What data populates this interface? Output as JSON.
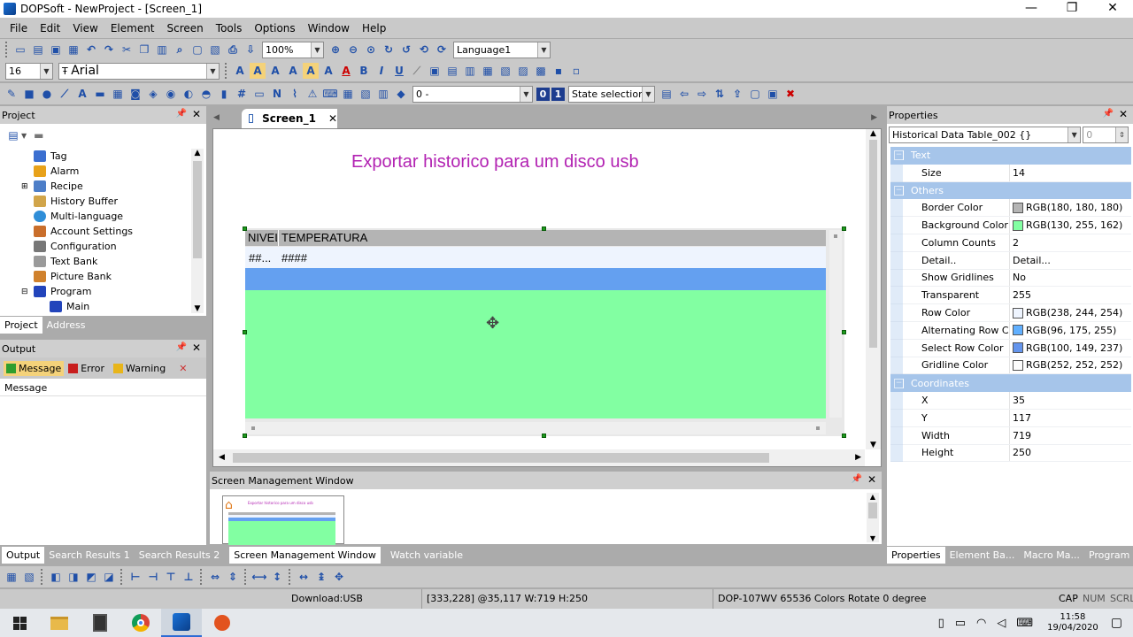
{
  "window": {
    "title": "DOPSoft - NewProject - [Screen_1]",
    "minimize": "—",
    "maximize": "❐",
    "close": "✕"
  },
  "menu": [
    "File",
    "Edit",
    "View",
    "Element",
    "Screen",
    "Tools",
    "Options",
    "Window",
    "Help"
  ],
  "toolbar1": {
    "zoom": "100%",
    "language": "Language1"
  },
  "toolbar2": {
    "font_size": "16",
    "font_name": "Arial"
  },
  "toolbar3": {
    "state_combo": "0 -",
    "state_a": "0",
    "state_b": "1",
    "state_selection": "State selection..."
  },
  "project_panel": {
    "title": "Project",
    "items": [
      {
        "label": "Tag",
        "icon": "tag-icon",
        "color": "#3b6fd0"
      },
      {
        "label": "Alarm",
        "icon": "alarm-icon",
        "color": "#e8a21a"
      },
      {
        "label": "Recipe",
        "icon": "recipe-icon",
        "color": "#4d7ec8"
      },
      {
        "label": "History Buffer",
        "icon": "history-buffer-icon",
        "color": "#d1a54a"
      },
      {
        "label": "Multi-language",
        "icon": "globe-icon",
        "color": "#2f8ed8"
      },
      {
        "label": "Account Settings",
        "icon": "account-icon",
        "color": "#c96e2b"
      },
      {
        "label": "Configuration",
        "icon": "configuration-icon",
        "color": "#777777"
      },
      {
        "label": "Text Bank",
        "icon": "text-bank-icon",
        "color": "#9a9a9a"
      },
      {
        "label": "Picture Bank",
        "icon": "picture-bank-icon",
        "color": "#d0812c"
      },
      {
        "label": "Program",
        "icon": "program-icon",
        "color": "#2244bb"
      },
      {
        "label": "Main",
        "icon": "main-program-icon",
        "color": "#2244bb"
      }
    ],
    "tabs": [
      "Project",
      "Address"
    ]
  },
  "output_panel": {
    "title": "Output",
    "buttons": {
      "message": "Message",
      "error": "Error",
      "warning": "Warning"
    },
    "column": "Message"
  },
  "editor": {
    "tab": "Screen_1",
    "title_text": "Exportar historico para um disco usb",
    "table": {
      "header_col1": "NIVEL",
      "header_col2": "TEMPERATURA",
      "row1_col1": "##...",
      "row1_col2": "####",
      "colors": {
        "header": "#B4B4B4",
        "row": "#EEF4FE",
        "select": "#64A0F0",
        "background": "#82FFA2"
      }
    }
  },
  "screen_mgmt": {
    "title": "Screen Management Window",
    "thumb_text": "Exportar historico para um disco usb"
  },
  "bottom_tabs": [
    "Output",
    "Search Results 1",
    "Search Results 2",
    "Screen Management Window",
    "Watch variable"
  ],
  "properties": {
    "title": "Properties",
    "object": "Historical Data Table_002 {}",
    "object_index": "0",
    "categories": [
      {
        "name": "Text",
        "rows": [
          {
            "key": "Size",
            "value": "14"
          }
        ]
      },
      {
        "name": "Others",
        "rows": [
          {
            "key": "Border Color",
            "value": "RGB(180, 180, 180)",
            "swatch": "#B4B4B4"
          },
          {
            "key": "Background Color",
            "value": "RGB(130, 255, 162)",
            "swatch": "#82FFA2"
          },
          {
            "key": "Column Counts",
            "value": "2"
          },
          {
            "key": "Detail..",
            "value": "Detail..."
          },
          {
            "key": "Show Gridlines",
            "value": "No"
          },
          {
            "key": "Transparent",
            "value": "255"
          },
          {
            "key": "Row Color",
            "value": "RGB(238, 244, 254)",
            "swatch": "#EEF4FE"
          },
          {
            "key": "Alternating Row C",
            "value": "RGB(96, 175, 255)",
            "swatch": "#60AFFF"
          },
          {
            "key": "Select Row Color",
            "value": "RGB(100, 149, 237)",
            "swatch": "#6495ED"
          },
          {
            "key": "Gridline Color",
            "value": "RGB(252, 252, 252)",
            "swatch": "#FCFCFC"
          }
        ]
      },
      {
        "name": "Coordinates",
        "rows": [
          {
            "key": "X",
            "value": "35"
          },
          {
            "key": "Y",
            "value": "117"
          },
          {
            "key": "Width",
            "value": "719"
          },
          {
            "key": "Height",
            "value": "250"
          }
        ]
      }
    ],
    "tabs": [
      "Properties",
      "Element Ba...",
      "Macro Ma...",
      "Program e..."
    ]
  },
  "statusbar": {
    "download": "Download:USB",
    "coords": "[333,228] @35,117 W:719 H:250",
    "device": "DOP-107WV 65536 Colors Rotate 0 degree",
    "cap": "CAP",
    "num": "NUM",
    "scrl": "SCRL"
  },
  "taskbar": {
    "time": "11:58",
    "date": "19/04/2020"
  }
}
